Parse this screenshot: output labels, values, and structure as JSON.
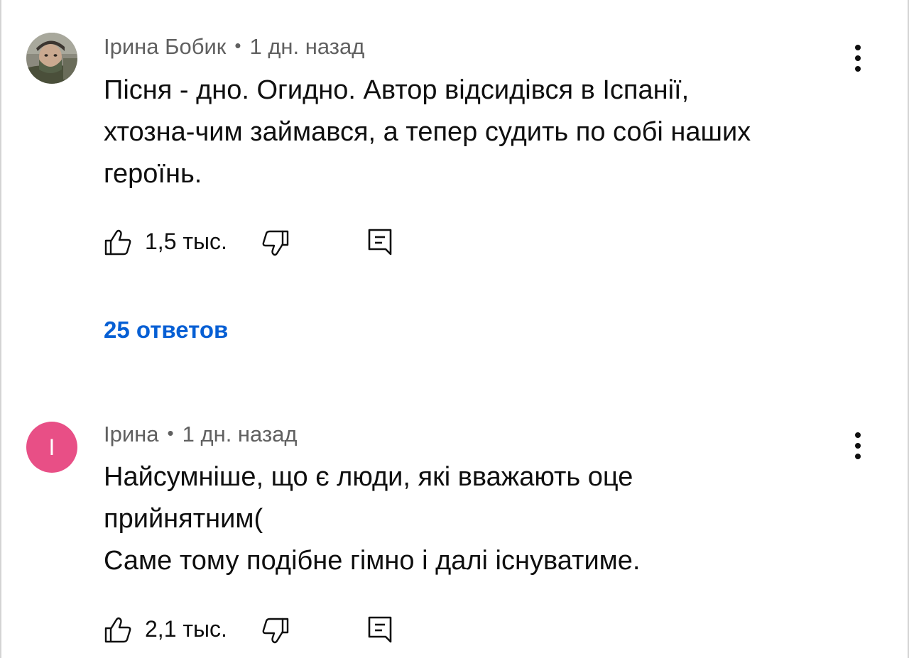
{
  "comments": [
    {
      "author": "Ірина Бобик",
      "time": "1 дн. назад",
      "avatar_letter": "",
      "avatar_type": "photo",
      "text_lines": [
        "Пісня - дно. Огидно. Автор відсидівся в Іспанії,",
        "хтозна-чим займався, а тепер судить по собі наших",
        "героїнь."
      ],
      "likes": "1,5 тыс.",
      "replies_label": "25 ответов"
    },
    {
      "author": "Ірина",
      "time": "1 дн. назад",
      "avatar_letter": "I",
      "avatar_type": "letter",
      "avatar_color": "#e84f86",
      "text_lines": [
        "Найсумніше, що є люди, які вважають оце",
        "прийнятним(",
        "Саме тому подібне гімно і далі існуватиме."
      ],
      "likes": "2,1 тыс."
    }
  ],
  "icons": {
    "like": "thumb-up-icon",
    "dislike": "thumb-down-icon",
    "reply": "comment-reply-icon",
    "menu": "more-vertical-icon"
  },
  "colors": {
    "link": "#065fd4",
    "meta": "#606060",
    "avatar_accent": "#e84f86"
  }
}
